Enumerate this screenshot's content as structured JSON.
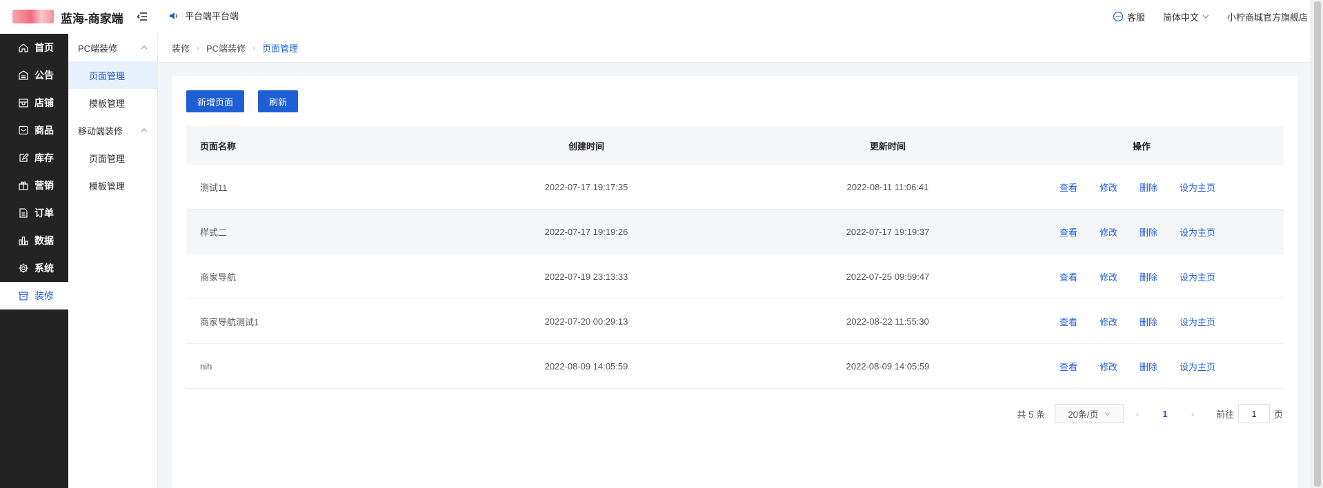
{
  "header": {
    "brand": "蓝海-商家端",
    "notice": "平台端平台端",
    "service": "客服",
    "language": "简体中文",
    "store": "小柠商城官方旗舰店"
  },
  "sidenav": {
    "items": [
      {
        "label": "首页",
        "icon": "home-icon"
      },
      {
        "label": "公告",
        "icon": "notice-icon"
      },
      {
        "label": "店铺",
        "icon": "store-icon"
      },
      {
        "label": "商品",
        "icon": "product-icon"
      },
      {
        "label": "库存",
        "icon": "edit-icon"
      },
      {
        "label": "营销",
        "icon": "gift-icon"
      },
      {
        "label": "订单",
        "icon": "order-icon"
      },
      {
        "label": "数据",
        "icon": "chart-icon"
      },
      {
        "label": "系统",
        "icon": "gear-icon"
      },
      {
        "label": "装修",
        "icon": "decor-icon"
      }
    ]
  },
  "subnav": {
    "group1": "PC端装修",
    "group1_items": [
      "页面管理",
      "模板管理"
    ],
    "group2": "移动端装修",
    "group2_items": [
      "页面管理",
      "模板管理"
    ]
  },
  "breadcrumb": [
    "装修",
    "PC端装修",
    "页面管理"
  ],
  "toolbar": {
    "add_label": "新增页面",
    "refresh_label": "刷新"
  },
  "table": {
    "columns": [
      "页面名称",
      "创建时间",
      "更新时间",
      "操作"
    ],
    "rows": [
      {
        "name": "测试11",
        "created": "2022-07-17 19:17:35",
        "updated": "2022-08-11 11:06:41"
      },
      {
        "name": "样式二",
        "created": "2022-07-17 19:19:26",
        "updated": "2022-07-17 19:19:37"
      },
      {
        "name": "商家导航",
        "created": "2022-07-19 23:13:33",
        "updated": "2022-07-25 09:59:47"
      },
      {
        "name": "商家导航测试1",
        "created": "2022-07-20 00:29:13",
        "updated": "2022-08-22 11:55:30"
      },
      {
        "name": "nih",
        "created": "2022-08-09 14:05:59",
        "updated": "2022-08-09 14:05:59"
      }
    ],
    "actions": [
      "查看",
      "修改",
      "删除",
      "设为主页"
    ]
  },
  "pagination": {
    "total": "共 5 条",
    "page_size": "20条/页",
    "current": "1",
    "goto_prefix": "前往",
    "goto_value": "1",
    "goto_suffix": "页"
  },
  "colors": {
    "primary": "#1f5fd6",
    "sidebar": "#232323"
  }
}
